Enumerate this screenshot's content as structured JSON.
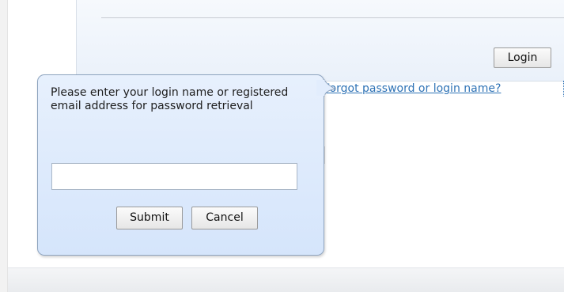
{
  "login_form": {
    "login_button_label": "Login",
    "forgot_link_text": "Forgot password or login name?"
  },
  "password_popup": {
    "instructions": "Please enter your login name or registered email address for password retrieval",
    "input_value": "",
    "input_placeholder": "",
    "submit_label": "Submit",
    "cancel_label": "Cancel"
  },
  "colors": {
    "popup_background": "#dce8fc",
    "popup_border": "#8ea4bf",
    "link": "#2f73b6",
    "form_background": "#eef3fa",
    "footer": "#eceef1"
  }
}
